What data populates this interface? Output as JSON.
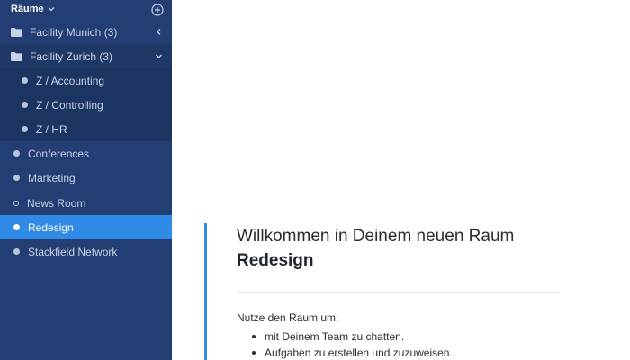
{
  "sidebar": {
    "title": "Räume",
    "folders": [
      {
        "label": "Facility Munich (3)",
        "expanded": false
      },
      {
        "label": "Facility Zurich (3)",
        "expanded": true,
        "children": [
          "Z / Accounting",
          "Z / Controlling",
          "Z / HR"
        ]
      }
    ],
    "rooms": [
      {
        "label": "Conferences",
        "style": "dot"
      },
      {
        "label": "Marketing",
        "style": "dot"
      },
      {
        "label": "News Room",
        "style": "ring"
      },
      {
        "label": "Redesign",
        "style": "dot",
        "active": true
      },
      {
        "label": "Stackfield Network",
        "style": "dot"
      }
    ]
  },
  "main": {
    "welcome_title": "Willkommen in Deinem neuen Raum",
    "room_name": "Redesign",
    "intro": "Nutze den Raum um:",
    "bullets": [
      "mit Deinem Team zu chatten.",
      "Aufgaben zu erstellen und zuzuweisen."
    ]
  },
  "colors": {
    "sidebar_bg": "#233e72",
    "sub_bg": "#1c3461",
    "active": "#2f8be6",
    "accent_bar": "#2f8be6"
  },
  "icons": {
    "add": "plus-circle-icon",
    "folder": "folder-icon",
    "collapsed": "chevron-left-icon",
    "expanded": "chevron-down-icon",
    "title_toggle": "chevron-down-icon"
  }
}
